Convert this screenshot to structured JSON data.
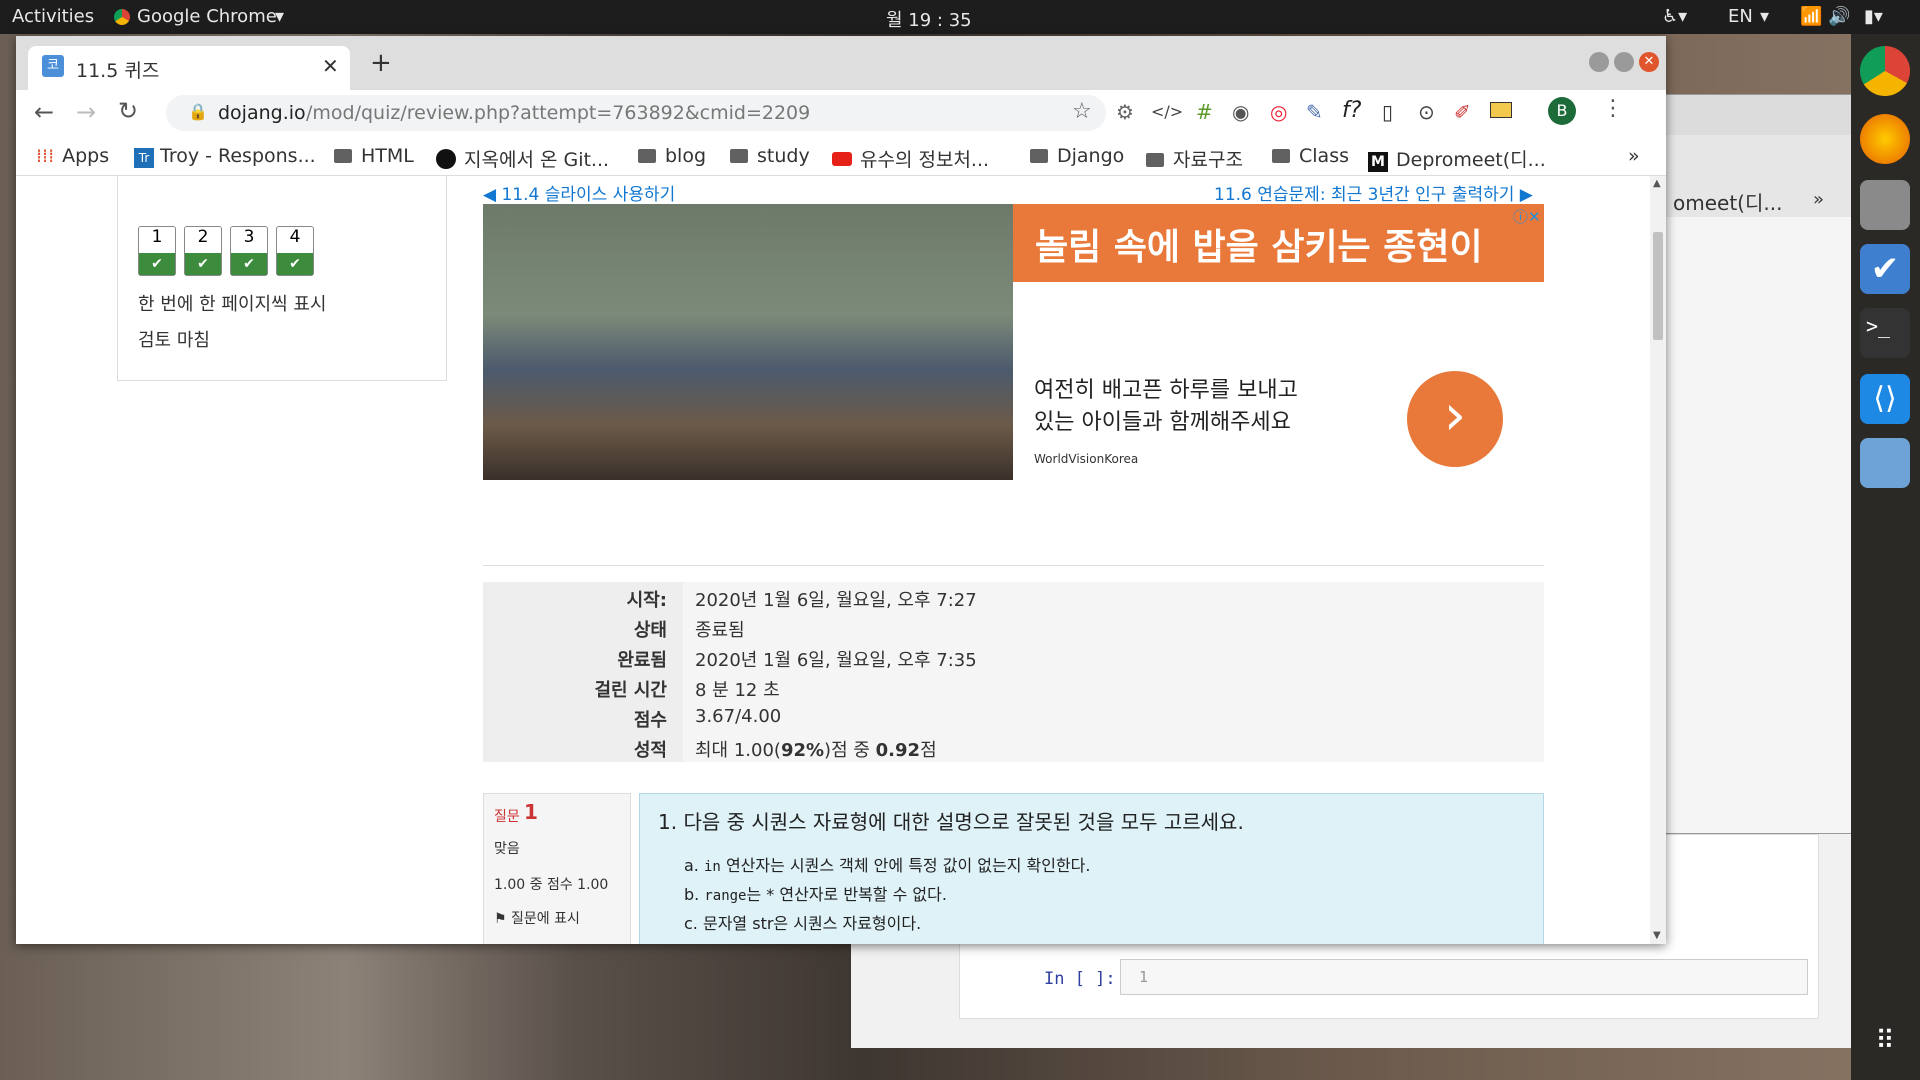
{
  "topbar": {
    "activities": "Activities",
    "app_name": "Google Chrome",
    "clock": "월 19 : 35",
    "lang": "EN"
  },
  "browser": {
    "tab_title": "11.5 퀴즈",
    "tab_favicon": "코",
    "url_domain": "dojang.io",
    "url_path": "/mod/quiz/review.php?attempt=763892&cmid=2209",
    "profile_letter": "B"
  },
  "bookmarks": [
    {
      "label": "Apps",
      "icon": "apps-grid-icon"
    },
    {
      "label": "Troy - Respons...",
      "icon": "trello-icon"
    },
    {
      "label": "HTML",
      "icon": "folder-icon"
    },
    {
      "label": "지옥에서 온 Git...",
      "icon": "black-circle-icon"
    },
    {
      "label": "blog",
      "icon": "folder-icon"
    },
    {
      "label": "study",
      "icon": "folder-icon"
    },
    {
      "label": "유수의 정보처...",
      "icon": "youtube-icon"
    },
    {
      "label": "Django",
      "icon": "folder-icon"
    },
    {
      "label": "자료구조",
      "icon": "folder-icon"
    },
    {
      "label": "Class",
      "icon": "folder-icon"
    },
    {
      "label": "Depromeet(디...",
      "icon": "medium-icon"
    }
  ],
  "bookmarks_overflow": "»",
  "quiz_nav": {
    "questions": [
      "1",
      "2",
      "3",
      "4"
    ],
    "show_one_page": "한 번에 한 페이지씩 표시",
    "finish_review": "검토 마침"
  },
  "page_nav": {
    "prev": "11.4 슬라이스 사용하기",
    "next": "11.6 연습문제: 최근 3년간 인구 출력하기"
  },
  "ad": {
    "headline": "놀림 속에 밥을 삼키는 종현이",
    "line1": "여전히 배고픈 하루를 보내고",
    "line2": "있는 아이들과 함께해주세요",
    "brand": "WorldVisionKorea",
    "go_arrow": "›"
  },
  "summary": [
    {
      "label": "시작:",
      "value": "2020년 1월 6일, 월요일, 오후 7:27"
    },
    {
      "label": "상태",
      "value": "종료됨"
    },
    {
      "label": "완료됨",
      "value": "2020년 1월 6일, 월요일, 오후 7:35"
    },
    {
      "label": "걸린 시간",
      "value": "8 분 12 초"
    },
    {
      "label": "점수",
      "value": "3.67/4.00"
    },
    {
      "label": "성적",
      "value_pre": "최대 1.00(",
      "value_bold1": "92%",
      "value_mid": ")점 중 ",
      "value_bold2": "0.92",
      "value_post": "점"
    }
  ],
  "question": {
    "label": "질문",
    "number": "1",
    "status": "맞음",
    "score": "1.00 중 점수 1.00",
    "flag": "질문에 표시",
    "text": "1. 다음 중 시퀀스 자료형에 대한 설명으로 잘못된 것을 모두 고르세요.",
    "options": [
      {
        "letter": "a.",
        "code": "in",
        "text": "연산자는 시퀀스 객체 안에 특정 값이 없는지 확인한다."
      },
      {
        "letter": "b.",
        "code": "range",
        "text": "는 * 연산자로 반복할 수 없다."
      },
      {
        "letter": "c.",
        "code": "",
        "text": "문자열 str은 시퀀스 자료형이다."
      }
    ]
  },
  "bg_window": {
    "title_frag": "omeet(디...",
    "overflow": "»"
  },
  "jupyter": {
    "prompt": "In [ ]:",
    "line_no": "1"
  }
}
